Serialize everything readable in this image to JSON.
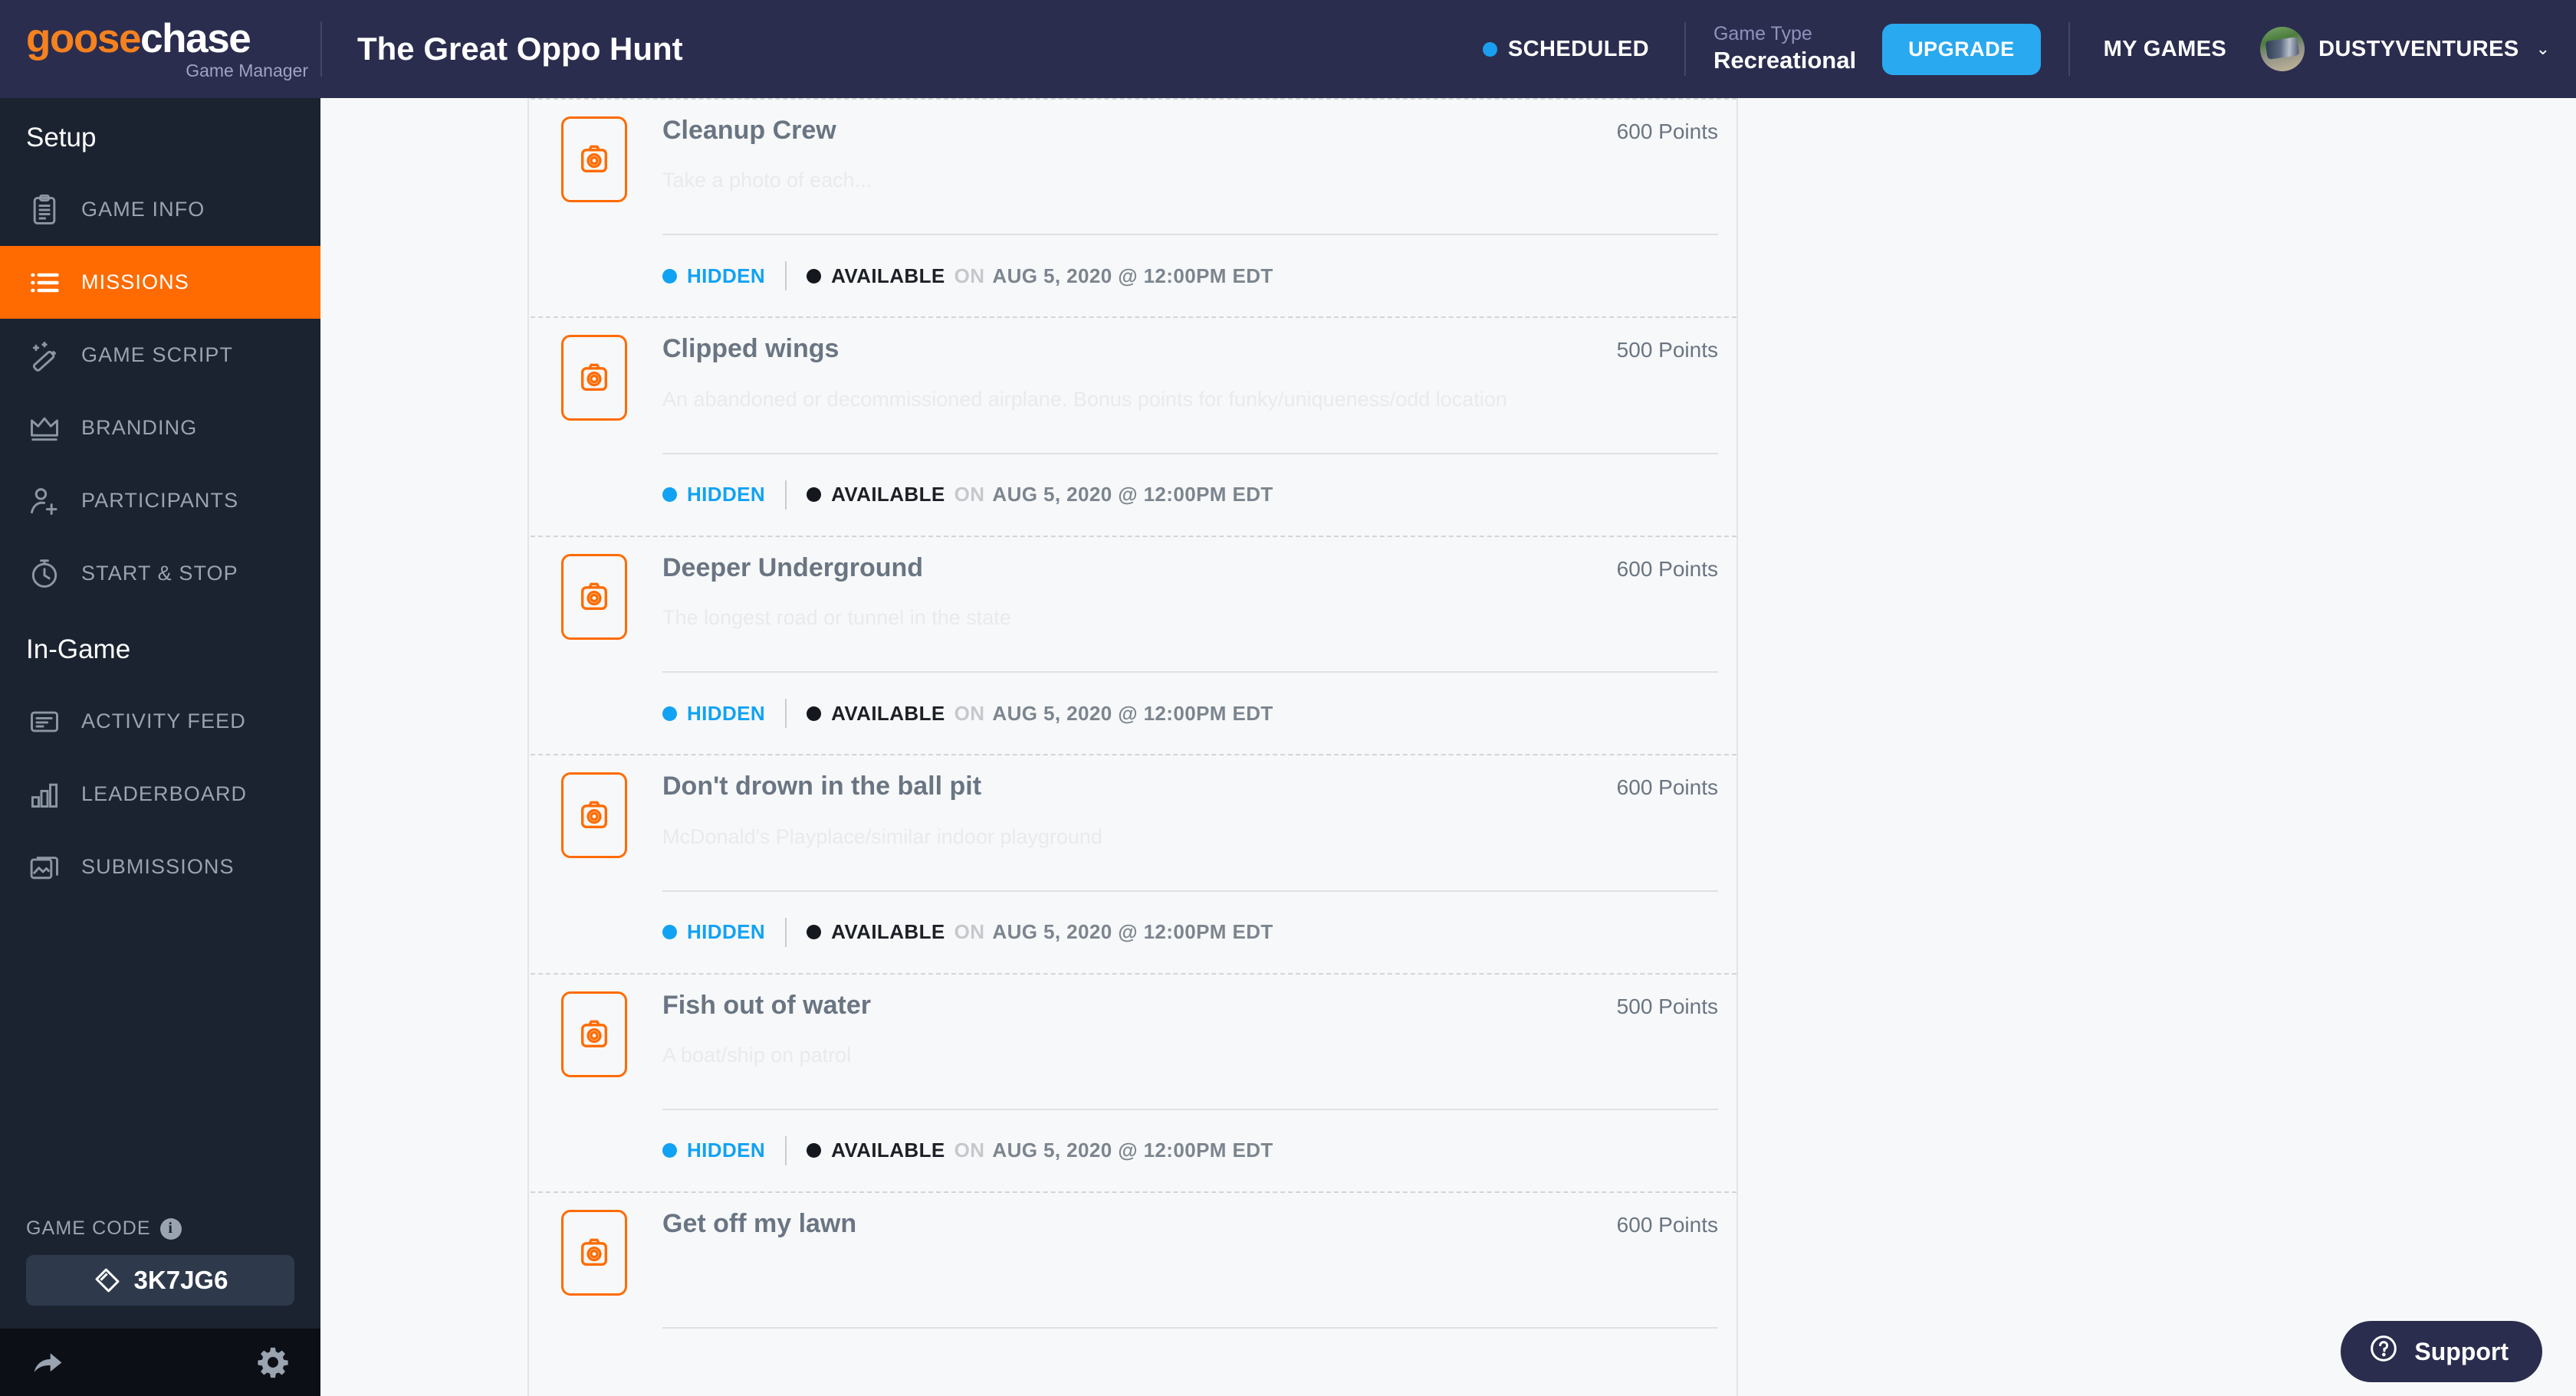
{
  "brand": {
    "logo_part1": "goose",
    "logo_part2": "chase",
    "subtitle": "Game Manager"
  },
  "header": {
    "game_title": "The Great Oppo Hunt",
    "status_label": "SCHEDULED",
    "status_color": "#1a9ff0",
    "game_type_label": "Game Type",
    "game_type_value": "Recreational",
    "upgrade_label": "UPGRADE",
    "upgrade_color": "#29a9ef",
    "my_games_label": "MY GAMES",
    "user_name": "DUSTYVENTURES",
    "chevron": "⌄"
  },
  "sidebar": {
    "bg_color": "#1b2330",
    "active_color": "#ff6b00",
    "sections": [
      {
        "heading": "Setup",
        "items": [
          {
            "label": "GAME INFO",
            "icon": "clipboard-icon",
            "active": false
          },
          {
            "label": "MISSIONS",
            "icon": "list-icon",
            "active": true
          },
          {
            "label": "GAME SCRIPT",
            "icon": "magic-wand-icon",
            "active": false
          },
          {
            "label": "BRANDING",
            "icon": "crown-icon",
            "active": false
          },
          {
            "label": "PARTICIPANTS",
            "icon": "add-person-icon",
            "active": false
          },
          {
            "label": "START & STOP",
            "icon": "stopwatch-icon",
            "active": false
          }
        ]
      },
      {
        "heading": "In-Game",
        "items": [
          {
            "label": "ACTIVITY FEED",
            "icon": "feed-icon",
            "active": false
          },
          {
            "label": "LEADERBOARD",
            "icon": "bar-chart-icon",
            "active": false
          },
          {
            "label": "SUBMISSIONS",
            "icon": "photos-icon",
            "active": false
          }
        ]
      }
    ],
    "game_code": {
      "label": "GAME CODE",
      "info_icon": "info-icon",
      "value": "3K7JG6",
      "ticket_icon": "ticket-icon"
    },
    "footer": {
      "share_icon": "share-arrow-icon",
      "settings_icon": "gear-icon"
    }
  },
  "missions": {
    "points_suffix": "Points",
    "status": {
      "hidden_label": "HIDDEN",
      "hidden_color": "#11a2f3",
      "available_label": "AVAILABLE",
      "on_label": "ON",
      "date": "AUG 5, 2020 @ 12:00PM EDT"
    },
    "items": [
      {
        "title": "Cleanup Crew",
        "points": "600 Points",
        "description": "Take a photo of each... ",
        "icon": "camera-icon",
        "hidden_label": "HIDDEN",
        "available_label": "AVAILABLE",
        "on_label": "ON",
        "date": "AUG 5, 2020 @ 12:00PM EDT"
      },
      {
        "title": "Clipped wings",
        "points": "500 Points",
        "description": "An abandoned or decommissioned airplane. Bonus points for funky/uniqueness/odd location",
        "icon": "camera-icon",
        "hidden_label": "HIDDEN",
        "available_label": "AVAILABLE",
        "on_label": "ON",
        "date": "AUG 5, 2020 @ 12:00PM EDT"
      },
      {
        "title": "Deeper Underground",
        "points": "600 Points",
        "description": "The longest road or tunnel in the state",
        "icon": "camera-icon",
        "hidden_label": "HIDDEN",
        "available_label": "AVAILABLE",
        "on_label": "ON",
        "date": "AUG 5, 2020 @ 12:00PM EDT"
      },
      {
        "title": "Don't drown in the ball pit",
        "points": "600 Points",
        "description": "McDonald's Playplace/similar indoor playground",
        "icon": "camera-icon",
        "hidden_label": "HIDDEN",
        "available_label": "AVAILABLE",
        "on_label": "ON",
        "date": "AUG 5, 2020 @ 12:00PM EDT"
      },
      {
        "title": "Fish out of water",
        "points": "500 Points",
        "description": "A boat/ship on patrol",
        "icon": "camera-icon",
        "hidden_label": "HIDDEN",
        "available_label": "AVAILABLE",
        "on_label": "ON",
        "date": "AUG 5, 2020 @ 12:00PM EDT"
      },
      {
        "title": "Get off my lawn",
        "points": "600 Points",
        "description": "",
        "icon": "camera-icon",
        "hidden_label": "",
        "available_label": "",
        "on_label": "",
        "date": ""
      }
    ]
  },
  "support": {
    "label": "Support",
    "icon": "question-circle-icon"
  }
}
